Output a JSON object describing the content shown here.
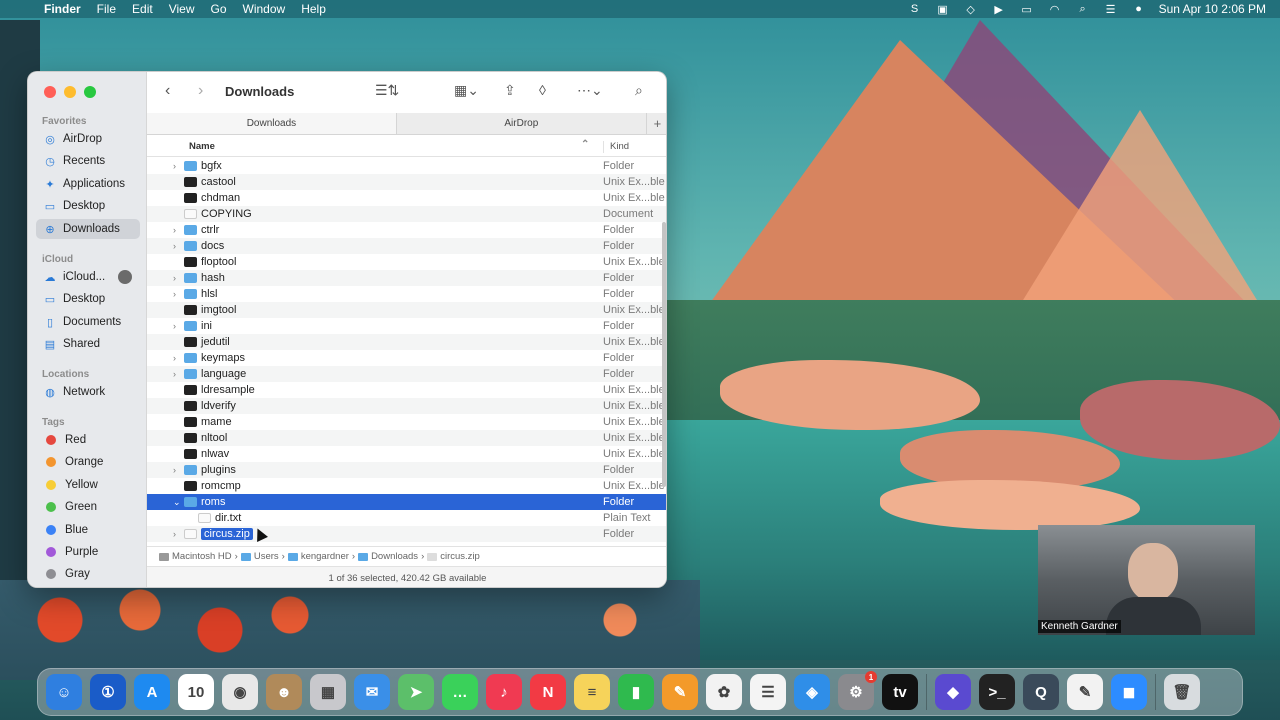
{
  "menubar": {
    "app": "Finder",
    "items": [
      "File",
      "Edit",
      "View",
      "Go",
      "Window",
      "Help"
    ],
    "clock": "Sun Apr 10  2:06 PM"
  },
  "finder": {
    "title": "Downloads",
    "tabs": [
      "Downloads",
      "AirDrop"
    ],
    "columns": {
      "name": "Name",
      "kind": "Kind"
    },
    "sidebar": {
      "favorites_header": "Favorites",
      "favorites": [
        {
          "label": "AirDrop",
          "icon": "airdrop-icon"
        },
        {
          "label": "Recents",
          "icon": "clock-icon"
        },
        {
          "label": "Applications",
          "icon": "applications-icon"
        },
        {
          "label": "Desktop",
          "icon": "desktop-icon"
        },
        {
          "label": "Downloads",
          "icon": "downloads-icon"
        }
      ],
      "icloud_header": "iCloud",
      "icloud": [
        {
          "label": "iCloud..."
        },
        {
          "label": "Desktop"
        },
        {
          "label": "Documents"
        },
        {
          "label": "Shared"
        }
      ],
      "locations_header": "Locations",
      "locations": [
        {
          "label": "Network"
        }
      ],
      "tags_header": "Tags",
      "tags": [
        {
          "label": "Red",
          "color": "#e5483f"
        },
        {
          "label": "Orange",
          "color": "#f3952f"
        },
        {
          "label": "Yellow",
          "color": "#f7cd36"
        },
        {
          "label": "Green",
          "color": "#4cc04c"
        },
        {
          "label": "Blue",
          "color": "#3b82f6"
        },
        {
          "label": "Purple",
          "color": "#a259d9"
        },
        {
          "label": "Gray",
          "color": "#8e8e93"
        }
      ]
    },
    "files": [
      {
        "name": "bgfx",
        "kind": "Folder",
        "type": "folder"
      },
      {
        "name": "castool",
        "kind": "Unix Ex...ble",
        "type": "exec"
      },
      {
        "name": "chdman",
        "kind": "Unix Ex...ble",
        "type": "exec"
      },
      {
        "name": "COPYING",
        "kind": "Document",
        "type": "doc"
      },
      {
        "name": "ctrlr",
        "kind": "Folder",
        "type": "folder"
      },
      {
        "name": "docs",
        "kind": "Folder",
        "type": "folder"
      },
      {
        "name": "floptool",
        "kind": "Unix Ex...ble",
        "type": "exec"
      },
      {
        "name": "hash",
        "kind": "Folder",
        "type": "folder"
      },
      {
        "name": "hlsl",
        "kind": "Folder",
        "type": "folder"
      },
      {
        "name": "imgtool",
        "kind": "Unix Ex...ble",
        "type": "exec"
      },
      {
        "name": "ini",
        "kind": "Folder",
        "type": "folder"
      },
      {
        "name": "jedutil",
        "kind": "Unix Ex...ble",
        "type": "exec"
      },
      {
        "name": "keymaps",
        "kind": "Folder",
        "type": "folder"
      },
      {
        "name": "language",
        "kind": "Folder",
        "type": "folder"
      },
      {
        "name": "ldresample",
        "kind": "Unix Ex...ble",
        "type": "exec"
      },
      {
        "name": "ldverify",
        "kind": "Unix Ex...ble",
        "type": "exec"
      },
      {
        "name": "mame",
        "kind": "Unix Ex...ble",
        "type": "exec"
      },
      {
        "name": "nltool",
        "kind": "Unix Ex...ble",
        "type": "exec"
      },
      {
        "name": "nlwav",
        "kind": "Unix Ex...ble",
        "type": "exec"
      },
      {
        "name": "plugins",
        "kind": "Folder",
        "type": "folder"
      },
      {
        "name": "romcmp",
        "kind": "Unix Ex...ble",
        "type": "exec"
      },
      {
        "name": "roms",
        "kind": "Folder",
        "type": "folder",
        "selected": true,
        "expanded": true
      },
      {
        "name": "dir.txt",
        "kind": "Plain Text",
        "type": "doc",
        "child": true
      },
      {
        "name": "circus.zip",
        "kind": "Folder",
        "type": "zip",
        "renaming": true
      }
    ],
    "path": [
      "Macintosh HD",
      "Users",
      "kengardner",
      "Downloads",
      "circus.zip"
    ],
    "status": "1 of 36 selected, 420.42 GB available"
  },
  "video": {
    "name": "Kenneth Gardner"
  },
  "dock": [
    {
      "name": "finder",
      "color": "#2f7fe0",
      "glyph": "☺"
    },
    {
      "name": "1password",
      "color": "#1a5cc8",
      "glyph": "①"
    },
    {
      "name": "app-store",
      "color": "#1e8af0",
      "glyph": "A"
    },
    {
      "name": "calendar",
      "color": "#ffffff",
      "glyph": "10"
    },
    {
      "name": "chrome",
      "color": "#e8e8e8",
      "glyph": "◉"
    },
    {
      "name": "contacts",
      "color": "#b08a5a",
      "glyph": "☻"
    },
    {
      "name": "launchpad",
      "color": "#c8c8cc",
      "glyph": "▦"
    },
    {
      "name": "mail",
      "color": "#3a8fe8",
      "glyph": "✉"
    },
    {
      "name": "maps",
      "color": "#5cbf6a",
      "glyph": "➤"
    },
    {
      "name": "messages",
      "color": "#3ad15a",
      "glyph": "…"
    },
    {
      "name": "music",
      "color": "#f03a52",
      "glyph": "♪"
    },
    {
      "name": "news",
      "color": "#f23a44",
      "glyph": "N"
    },
    {
      "name": "notes",
      "color": "#f6d35a",
      "glyph": "≡"
    },
    {
      "name": "numbers",
      "color": "#2fba4e",
      "glyph": "▮"
    },
    {
      "name": "pages",
      "color": "#f39a2a",
      "glyph": "✎"
    },
    {
      "name": "photos",
      "color": "#f2f2f2",
      "glyph": "✿"
    },
    {
      "name": "reminders",
      "color": "#f4f4f4",
      "glyph": "☰"
    },
    {
      "name": "safari",
      "color": "#2f8ee8",
      "glyph": "◈"
    },
    {
      "name": "system-preferences",
      "color": "#8a8a8e",
      "glyph": "⚙",
      "badge": "1"
    },
    {
      "name": "apple-tv",
      "color": "#111111",
      "glyph": "tv"
    },
    {
      "name": "shortcuts",
      "color": "#5a4ad0",
      "glyph": "◆"
    },
    {
      "name": "terminal",
      "color": "#222222",
      "glyph": ">_"
    },
    {
      "name": "quicktime",
      "color": "#3a4a5a",
      "glyph": "Q"
    },
    {
      "name": "textedit",
      "color": "#f2f2f2",
      "glyph": "✎"
    },
    {
      "name": "zoom",
      "color": "#2d8cff",
      "glyph": "◼"
    },
    {
      "name": "trash",
      "color": "#d8dcdf",
      "glyph": "🗑"
    }
  ]
}
